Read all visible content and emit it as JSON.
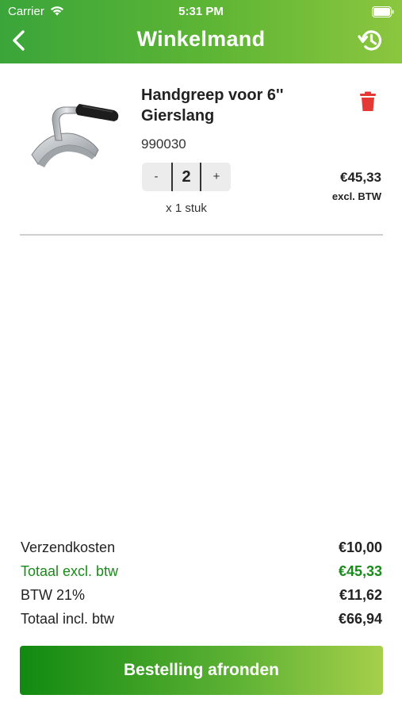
{
  "status_bar": {
    "carrier": "Carrier",
    "time": "5:31 PM"
  },
  "nav": {
    "title": "Winkelmand",
    "back_icon": "chevron-left-icon",
    "history_icon": "history-icon"
  },
  "cart_item": {
    "name": "Handgreep voor 6'' Gierslang",
    "sku": "990030",
    "quantity": "2",
    "minus_label": "-",
    "plus_label": "+",
    "unit": "x 1 stuk",
    "price": "€45,33",
    "price_note": "excl. BTW",
    "delete_icon": "trash-icon",
    "delete_color": "#e53935"
  },
  "summary": {
    "rows": [
      {
        "label": "Verzendkosten",
        "value": "€10,00"
      },
      {
        "label": "Totaal excl. btw",
        "value": "€45,33"
      },
      {
        "label": "BTW 21%",
        "value": "€11,62"
      },
      {
        "label": "Totaal incl. btw",
        "value": "€66,94"
      }
    ]
  },
  "checkout_button": "Bestelling afronden",
  "colors": {
    "accent_green": "#1a8a1a",
    "header_start": "#3aa53a",
    "header_end": "#8cc63f"
  }
}
